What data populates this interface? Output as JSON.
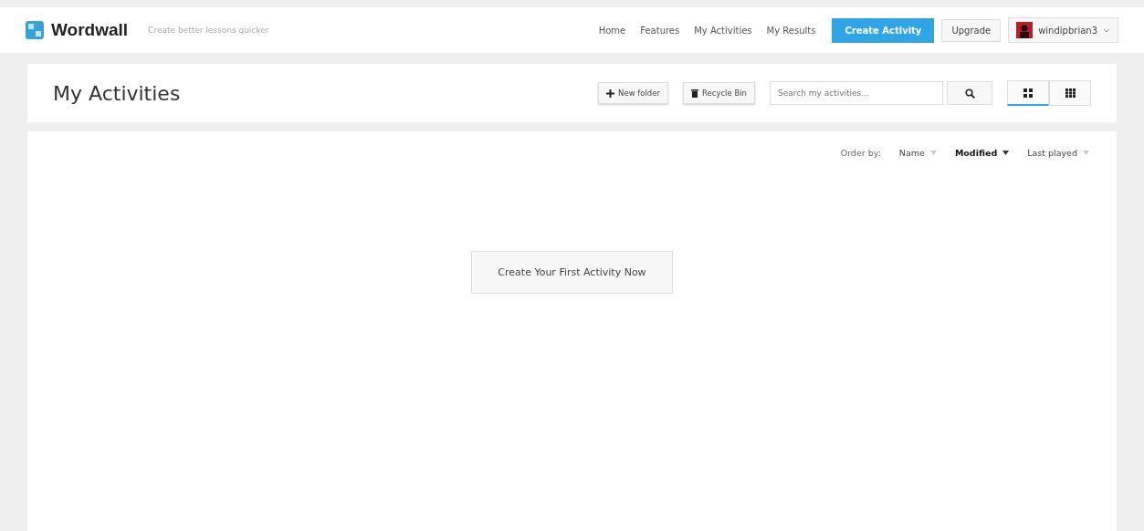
{
  "brand": {
    "name": "Wordwall",
    "tagline": "Create better lessons quicker"
  },
  "nav": {
    "links": [
      "Home",
      "Features",
      "My Activities",
      "My Results"
    ],
    "create_button": "Create Activity",
    "upgrade_button": "Upgrade",
    "user": "windipbrian3"
  },
  "header": {
    "title": "My Activities",
    "new_folder": "New folder",
    "recycle_bin": "Recycle Bin",
    "search": {
      "placeholder": "Search my activities..."
    },
    "views": [
      {
        "kind": "large",
        "selected": true
      },
      {
        "kind": "small",
        "selected": false
      }
    ]
  },
  "order": {
    "label": "Order by:",
    "options": [
      {
        "label": "Name",
        "selected": false
      },
      {
        "label": "Modified",
        "selected": true
      },
      {
        "label": "Last played",
        "selected": false
      }
    ]
  },
  "empty_button": "Create Your First Activity Now"
}
